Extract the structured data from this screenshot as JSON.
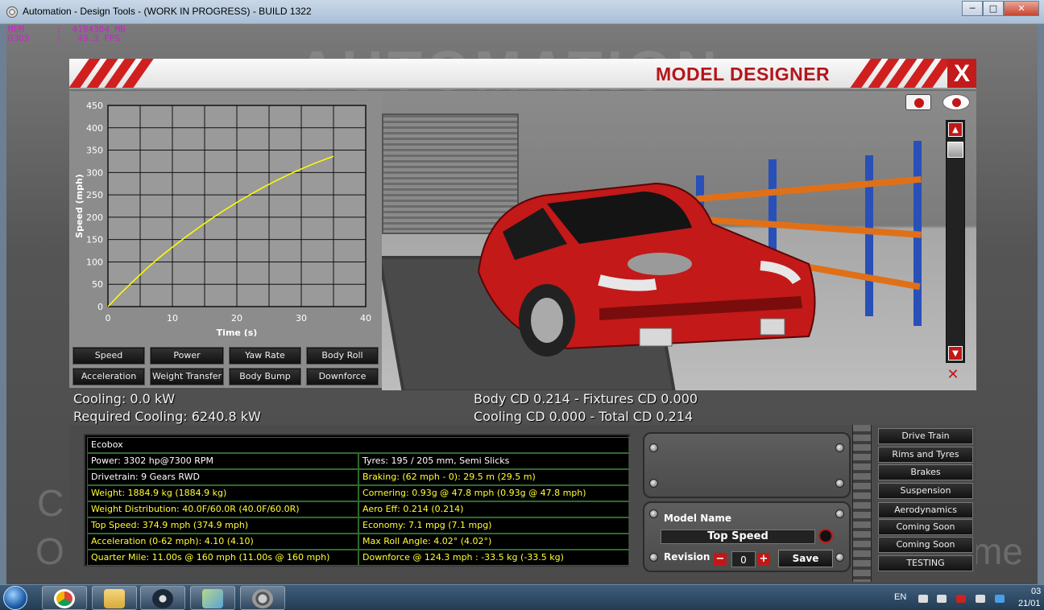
{
  "window": {
    "title": "Automation - Design Tools - (WORK IN PROGRESS) - BUILD 1322",
    "min_label": "─",
    "max_label": "□",
    "close_label": "✕"
  },
  "debug": {
    "mem_line": "MEM      :  4194304 MB",
    "fps_line": "D3D9     :   49.3 FPS"
  },
  "background": {
    "logo_text": "AUTOMATION",
    "side_left_1": "C",
    "side_left_2": "O",
    "side_right": "me"
  },
  "designer": {
    "title": "MODEL DESIGNER",
    "close_label": "X"
  },
  "graph_buttons": [
    "Speed",
    "Power",
    "Yaw Rate",
    "Body Roll",
    "Acceleration",
    "Weight Transfer",
    "Body Bump",
    "Downforce"
  ],
  "chart_data": {
    "type": "line",
    "title": "",
    "xlabel": "Time (s)",
    "ylabel": "Speed (mph)",
    "xlim": [
      0,
      40
    ],
    "ylim": [
      0,
      450
    ],
    "xticks": [
      "0",
      "10",
      "20",
      "30",
      "40"
    ],
    "yticks": [
      "0",
      "50",
      "100",
      "150",
      "200",
      "250",
      "300",
      "350",
      "400",
      "450"
    ],
    "grid": true,
    "series": [
      {
        "color": "#ffff00",
        "x": [
          0,
          2,
          4,
          6,
          8,
          10,
          12,
          14,
          16,
          18,
          20,
          22,
          24,
          26,
          28,
          30,
          32,
          34,
          35
        ],
        "y": [
          0,
          30,
          58,
          85,
          110,
          133,
          155,
          176,
          196,
          215,
          233,
          250,
          266,
          281,
          295,
          308,
          320,
          331,
          336
        ]
      }
    ]
  },
  "strip": {
    "cooling": "Cooling: 0.0 kW",
    "required_cooling": "Required Cooling: 6240.8 kW",
    "body_cd": "Body CD 0.214 - Fixtures CD 0.000",
    "cooling_cd": "Cooling CD 0.000 - Total CD 0.214"
  },
  "stats": {
    "name": "Ecobox",
    "left": [
      {
        "text": "Power: 3302 hp@7300 RPM",
        "color": "white"
      },
      {
        "text": "Drivetrain: 9 Gears RWD",
        "color": "white"
      },
      {
        "text": "Weight: 1884.9 kg (1884.9 kg)",
        "color": "yellow"
      },
      {
        "text": "Weight Distribution: 40.0F/60.0R (40.0F/60.0R)",
        "color": "yellow"
      },
      {
        "text": "Top Speed: 374.9 mph (374.9 mph)",
        "color": "yellow"
      },
      {
        "text": "Acceleration (0-62 mph): 4.10 (4.10)",
        "color": "yellow"
      },
      {
        "text": "Quarter Mile: 11.00s @ 160 mph (11.00s @ 160 mph)",
        "color": "yellow"
      }
    ],
    "right": [
      {
        "text": "Tyres: 195 / 205 mm, Semi Slicks",
        "color": "white"
      },
      {
        "text": "Braking: (62 mph - 0): 29.5 m (29.5 m)",
        "color": "yellow"
      },
      {
        "text": "Cornering: 0.93g @ 47.8 mph (0.93g @ 47.8 mph)",
        "color": "yellow"
      },
      {
        "text": "Aero Eff: 0.214 (0.214)",
        "color": "yellow"
      },
      {
        "text": "Economy: 7.1 mpg (7.1 mpg)",
        "color": "yellow"
      },
      {
        "text": "Max Roll Angle: 4.02° (4.02°)",
        "color": "yellow"
      },
      {
        "text": "Downforce @ 124.3 mph : -33.5 kg (-33.5 kg)",
        "color": "yellow"
      }
    ]
  },
  "model": {
    "name_label": "Model Name",
    "name_value": "Top Speed",
    "revision_label": "Revision",
    "revision_value": "0",
    "minus": "−",
    "plus": "+",
    "save_label": "Save"
  },
  "side_menu": [
    "Drive Train",
    "Rims and Tyres",
    "Brakes",
    "Suspension",
    "Aerodynamics",
    "Coming Soon",
    "Coming Soon",
    "TESTING"
  ],
  "taskbar": {
    "lang": "EN",
    "time": "03",
    "date": "21/01"
  }
}
